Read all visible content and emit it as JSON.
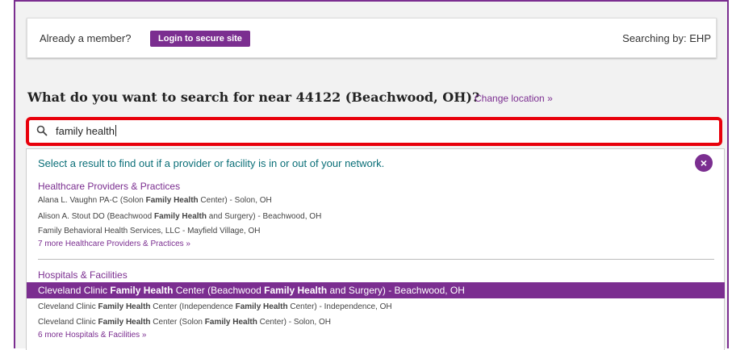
{
  "header": {
    "member_prompt": "Already a member?",
    "login_label": "Login to secure site",
    "searching_by": "Searching by: EHP"
  },
  "search": {
    "question": "What do you want to search for near 44122 (Beachwood, OH)?",
    "change_location": "Change location  »",
    "query": "family health"
  },
  "results": {
    "hint": "Select a result to find out if a provider or facility is in or out of your network.",
    "close_icon": "×",
    "groups": [
      {
        "title": "Healthcare Providers & Practices",
        "items": [
          {
            "pre": "Alana L. Vaughn PA-C (Solon ",
            "b1": "Family Health",
            "mid": " Center) - Solon, OH"
          },
          {
            "pre": "Alison A. Stout DO (Beachwood ",
            "b1": "Family Health",
            "mid": " and Surgery) - Beachwood, OH"
          },
          {
            "pre": "Family Behavioral Health Services, LLC - Mayfield Village, OH"
          }
        ],
        "more": "7 more Healthcare Providers & Practices »"
      },
      {
        "title": "Hospitals & Facilities",
        "selected": {
          "pre": "Cleveland Clinic ",
          "b1": "Family Health",
          "mid": " Center (Beachwood ",
          "b2": "Family Health",
          "post": " and Surgery) - Beachwood, OH"
        },
        "items": [
          {
            "pre": "Cleveland Clinic ",
            "b1": "Family Health",
            "mid": " Center (Independence ",
            "b2": "Family Health",
            "post": " Center) - Independence, OH"
          },
          {
            "pre": "Cleveland Clinic ",
            "b1": "Family Health",
            "mid": " Center (Solon ",
            "b2": "Family Health",
            "post": " Center) - Solon, OH"
          }
        ],
        "more": "6 more Hospitals & Facilities »"
      }
    ]
  },
  "colors": {
    "brand": "#7b2e90",
    "highlight_border": "#e8000b",
    "hint": "#0b6f78"
  }
}
